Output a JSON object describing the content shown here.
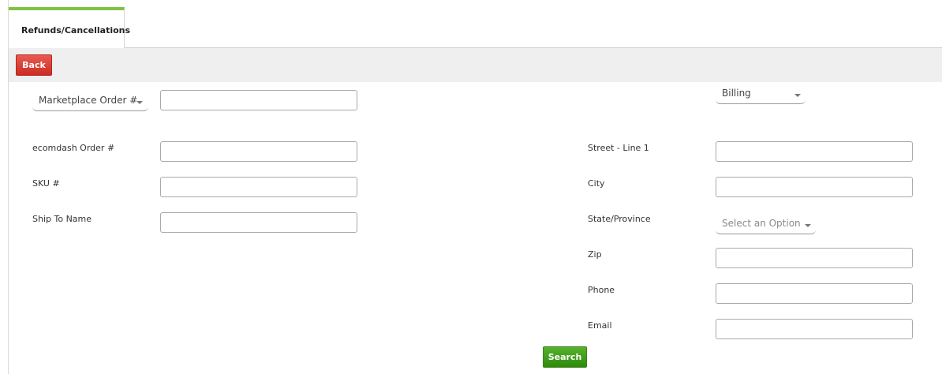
{
  "tabs": {
    "active_label": "Refunds/Cancellations"
  },
  "toolbar": {
    "back_label": "Back"
  },
  "search_type_dropdown": {
    "selected": "Marketplace Order #"
  },
  "address_type_dropdown": {
    "selected": "Billing"
  },
  "left_fields": {
    "ecomdash_order": {
      "label": "ecomdash Order #",
      "value": ""
    },
    "sku": {
      "label": "SKU #",
      "value": ""
    },
    "ship_to_name": {
      "label": "Ship To Name",
      "value": ""
    },
    "marketplace_order": {
      "value": ""
    }
  },
  "right_fields": {
    "street": {
      "label": "Street - Line 1",
      "value": ""
    },
    "city": {
      "label": "City",
      "value": ""
    },
    "state": {
      "label": "State/Province",
      "placeholder": "Select an Option"
    },
    "zip": {
      "label": "Zip",
      "value": ""
    },
    "phone": {
      "label": "Phone",
      "value": ""
    },
    "email": {
      "label": "Email",
      "value": ""
    }
  },
  "actions": {
    "search_label": "Search"
  },
  "colors": {
    "tab_accent": "#80c141",
    "back_button": "#cc2c23",
    "search_button": "#2e8a0c"
  }
}
